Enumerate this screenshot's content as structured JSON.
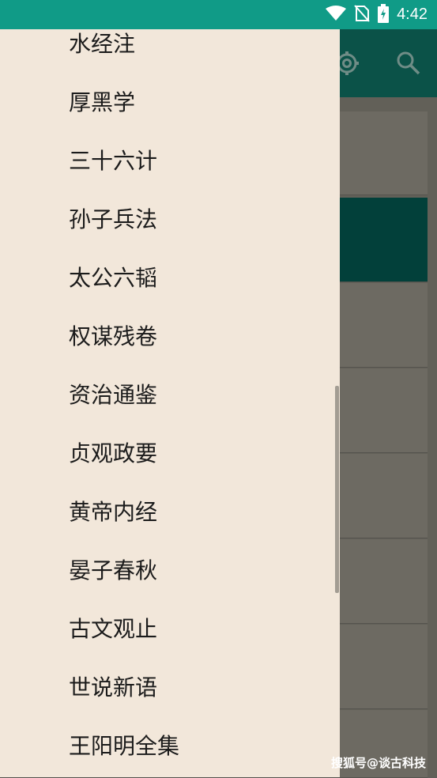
{
  "status_bar": {
    "time": "4:42",
    "icons": [
      "wifi-icon",
      "no-sim-icon",
      "battery-charging-icon"
    ]
  },
  "toolbar": {
    "icons": [
      "settings-icon",
      "search-icon"
    ]
  },
  "drawer": {
    "items": [
      {
        "label": "水经注"
      },
      {
        "label": "厚黑学"
      },
      {
        "label": "三十六计"
      },
      {
        "label": "孙子兵法"
      },
      {
        "label": "太公六韬"
      },
      {
        "label": "权谋残卷"
      },
      {
        "label": "资治通鉴"
      },
      {
        "label": "贞观政要"
      },
      {
        "label": "黄帝内经"
      },
      {
        "label": "晏子春秋"
      },
      {
        "label": "古文观止"
      },
      {
        "label": "世说新语"
      },
      {
        "label": "王阳明全集"
      }
    ]
  },
  "watermark": "搜狐号@谈古科技",
  "colors": {
    "status_bar": "#109b87",
    "toolbar": "#0b5248",
    "drawer_bg": "#f2e7da",
    "highlight_card": "#02403a"
  }
}
